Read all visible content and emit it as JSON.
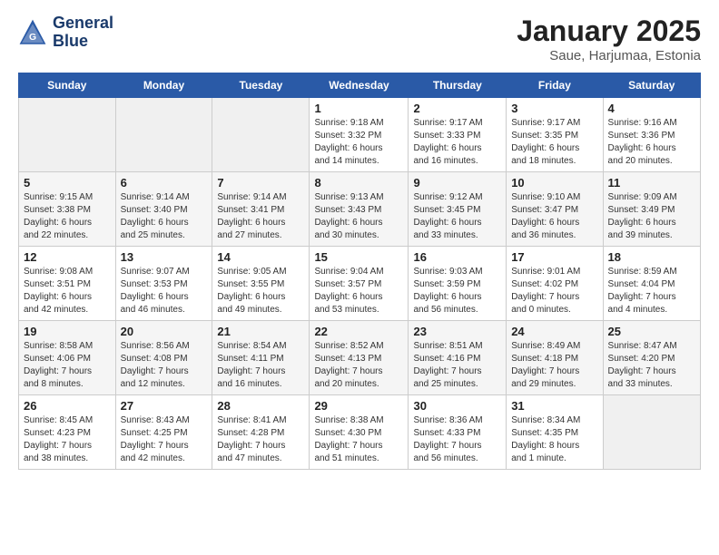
{
  "logo": {
    "line1": "General",
    "line2": "Blue"
  },
  "title": "January 2025",
  "subtitle": "Saue, Harjumaa, Estonia",
  "days_of_week": [
    "Sunday",
    "Monday",
    "Tuesday",
    "Wednesday",
    "Thursday",
    "Friday",
    "Saturday"
  ],
  "weeks": [
    [
      {
        "num": "",
        "info": ""
      },
      {
        "num": "",
        "info": ""
      },
      {
        "num": "",
        "info": ""
      },
      {
        "num": "1",
        "info": "Sunrise: 9:18 AM\nSunset: 3:32 PM\nDaylight: 6 hours\nand 14 minutes."
      },
      {
        "num": "2",
        "info": "Sunrise: 9:17 AM\nSunset: 3:33 PM\nDaylight: 6 hours\nand 16 minutes."
      },
      {
        "num": "3",
        "info": "Sunrise: 9:17 AM\nSunset: 3:35 PM\nDaylight: 6 hours\nand 18 minutes."
      },
      {
        "num": "4",
        "info": "Sunrise: 9:16 AM\nSunset: 3:36 PM\nDaylight: 6 hours\nand 20 minutes."
      }
    ],
    [
      {
        "num": "5",
        "info": "Sunrise: 9:15 AM\nSunset: 3:38 PM\nDaylight: 6 hours\nand 22 minutes."
      },
      {
        "num": "6",
        "info": "Sunrise: 9:14 AM\nSunset: 3:40 PM\nDaylight: 6 hours\nand 25 minutes."
      },
      {
        "num": "7",
        "info": "Sunrise: 9:14 AM\nSunset: 3:41 PM\nDaylight: 6 hours\nand 27 minutes."
      },
      {
        "num": "8",
        "info": "Sunrise: 9:13 AM\nSunset: 3:43 PM\nDaylight: 6 hours\nand 30 minutes."
      },
      {
        "num": "9",
        "info": "Sunrise: 9:12 AM\nSunset: 3:45 PM\nDaylight: 6 hours\nand 33 minutes."
      },
      {
        "num": "10",
        "info": "Sunrise: 9:10 AM\nSunset: 3:47 PM\nDaylight: 6 hours\nand 36 minutes."
      },
      {
        "num": "11",
        "info": "Sunrise: 9:09 AM\nSunset: 3:49 PM\nDaylight: 6 hours\nand 39 minutes."
      }
    ],
    [
      {
        "num": "12",
        "info": "Sunrise: 9:08 AM\nSunset: 3:51 PM\nDaylight: 6 hours\nand 42 minutes."
      },
      {
        "num": "13",
        "info": "Sunrise: 9:07 AM\nSunset: 3:53 PM\nDaylight: 6 hours\nand 46 minutes."
      },
      {
        "num": "14",
        "info": "Sunrise: 9:05 AM\nSunset: 3:55 PM\nDaylight: 6 hours\nand 49 minutes."
      },
      {
        "num": "15",
        "info": "Sunrise: 9:04 AM\nSunset: 3:57 PM\nDaylight: 6 hours\nand 53 minutes."
      },
      {
        "num": "16",
        "info": "Sunrise: 9:03 AM\nSunset: 3:59 PM\nDaylight: 6 hours\nand 56 minutes."
      },
      {
        "num": "17",
        "info": "Sunrise: 9:01 AM\nSunset: 4:02 PM\nDaylight: 7 hours\nand 0 minutes."
      },
      {
        "num": "18",
        "info": "Sunrise: 8:59 AM\nSunset: 4:04 PM\nDaylight: 7 hours\nand 4 minutes."
      }
    ],
    [
      {
        "num": "19",
        "info": "Sunrise: 8:58 AM\nSunset: 4:06 PM\nDaylight: 7 hours\nand 8 minutes."
      },
      {
        "num": "20",
        "info": "Sunrise: 8:56 AM\nSunset: 4:08 PM\nDaylight: 7 hours\nand 12 minutes."
      },
      {
        "num": "21",
        "info": "Sunrise: 8:54 AM\nSunset: 4:11 PM\nDaylight: 7 hours\nand 16 minutes."
      },
      {
        "num": "22",
        "info": "Sunrise: 8:52 AM\nSunset: 4:13 PM\nDaylight: 7 hours\nand 20 minutes."
      },
      {
        "num": "23",
        "info": "Sunrise: 8:51 AM\nSunset: 4:16 PM\nDaylight: 7 hours\nand 25 minutes."
      },
      {
        "num": "24",
        "info": "Sunrise: 8:49 AM\nSunset: 4:18 PM\nDaylight: 7 hours\nand 29 minutes."
      },
      {
        "num": "25",
        "info": "Sunrise: 8:47 AM\nSunset: 4:20 PM\nDaylight: 7 hours\nand 33 minutes."
      }
    ],
    [
      {
        "num": "26",
        "info": "Sunrise: 8:45 AM\nSunset: 4:23 PM\nDaylight: 7 hours\nand 38 minutes."
      },
      {
        "num": "27",
        "info": "Sunrise: 8:43 AM\nSunset: 4:25 PM\nDaylight: 7 hours\nand 42 minutes."
      },
      {
        "num": "28",
        "info": "Sunrise: 8:41 AM\nSunset: 4:28 PM\nDaylight: 7 hours\nand 47 minutes."
      },
      {
        "num": "29",
        "info": "Sunrise: 8:38 AM\nSunset: 4:30 PM\nDaylight: 7 hours\nand 51 minutes."
      },
      {
        "num": "30",
        "info": "Sunrise: 8:36 AM\nSunset: 4:33 PM\nDaylight: 7 hours\nand 56 minutes."
      },
      {
        "num": "31",
        "info": "Sunrise: 8:34 AM\nSunset: 4:35 PM\nDaylight: 8 hours\nand 1 minute."
      },
      {
        "num": "",
        "info": ""
      }
    ]
  ]
}
